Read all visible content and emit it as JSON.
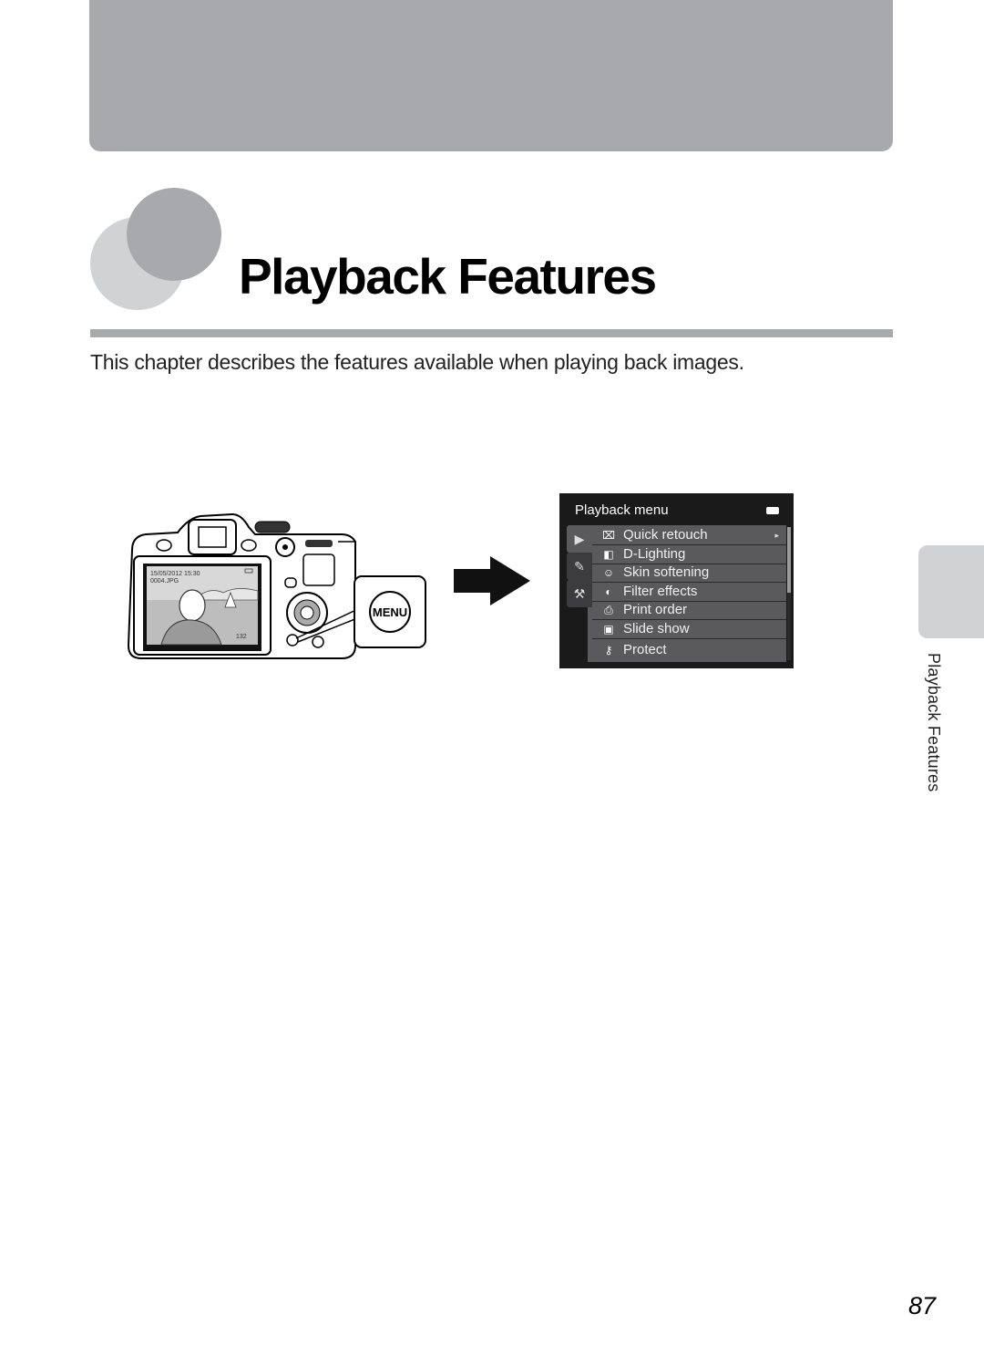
{
  "chapter": {
    "title": "Playback Features",
    "intro": "This chapter describes the features available when playing back images."
  },
  "camera_illustration": {
    "screen_datetime": "15/05/2012 15:30",
    "screen_filename": "0004.JPG",
    "screen_counter": "132",
    "menu_button_label": "MENU"
  },
  "menu_screen": {
    "title": "Playback menu",
    "tabs": [
      {
        "name": "playback",
        "icon": "playback-icon",
        "glyph": "▶"
      },
      {
        "name": "retouch",
        "icon": "retouch-icon",
        "glyph": "✎"
      },
      {
        "name": "setup",
        "icon": "wrench-icon",
        "glyph": "⚒"
      }
    ],
    "items": [
      {
        "label": "Quick retouch",
        "icon": "quick-retouch-icon",
        "glyph": "⌧"
      },
      {
        "label": "D-Lighting",
        "icon": "d-lighting-icon",
        "glyph": "◧"
      },
      {
        "label": "Skin softening",
        "icon": "skin-softening-icon",
        "glyph": "☺"
      },
      {
        "label": "Filter effects",
        "icon": "filter-effects-icon",
        "glyph": "◐"
      },
      {
        "label": "Print order",
        "icon": "print-order-icon",
        "glyph": "⎙"
      },
      {
        "label": "Slide show",
        "icon": "slide-show-icon",
        "glyph": "▣"
      },
      {
        "label": "Protect",
        "icon": "protect-key-icon",
        "glyph": "⚷"
      }
    ],
    "submenu_indicator": "▸"
  },
  "side_tab": {
    "label": "Playback Features"
  },
  "page": {
    "number": "87"
  }
}
